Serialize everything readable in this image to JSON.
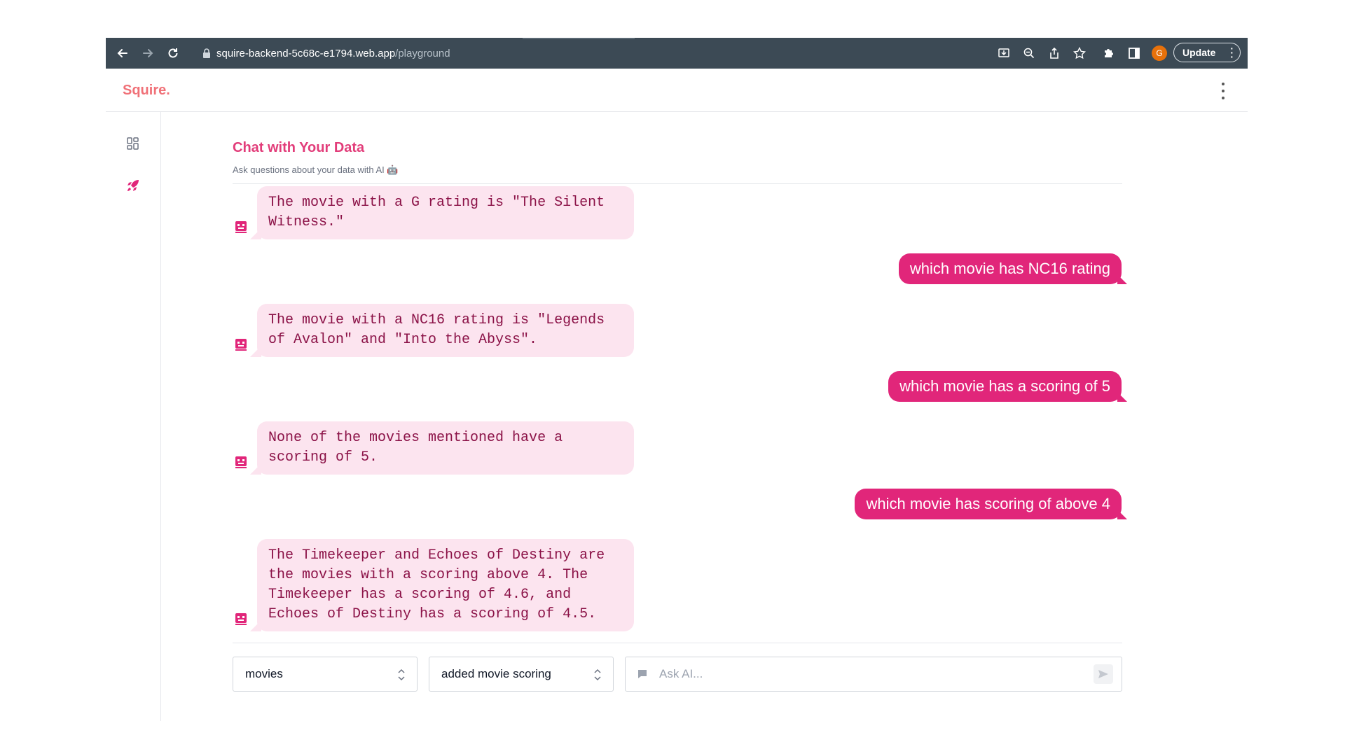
{
  "browser": {
    "url_host": "squire-backend-5c68c-e1794.web.app",
    "url_path": "/playground",
    "profile_initial": "G",
    "update_label": "Update"
  },
  "app": {
    "brand": "Squire."
  },
  "main": {
    "title": "Chat with Your Data",
    "subtitle": "Ask questions about your data with AI 🤖"
  },
  "messages": [
    {
      "role": "ai",
      "text": "The movie with a G rating is \"The Silent Witness.\""
    },
    {
      "role": "user",
      "text": "which movie has NC16 rating"
    },
    {
      "role": "ai",
      "text": "The movie with a NC16 rating is \"Legends of Avalon\" and \"Into the Abyss\"."
    },
    {
      "role": "user",
      "text": "which movie has a scoring of 5"
    },
    {
      "role": "ai",
      "text": "None of the movies mentioned have a scoring of 5."
    },
    {
      "role": "user",
      "text": "which movie has scoring of above 4"
    },
    {
      "role": "ai",
      "text": "The Timekeeper and Echoes of Destiny are the movies with a scoring above 4. The Timekeeper has a scoring of 4.6, and Echoes of Destiny has a scoring of 4.5."
    }
  ],
  "composer": {
    "dataset_select": "movies",
    "version_select": "added movie scoring",
    "ask_placeholder": "Ask AI..."
  },
  "colors": {
    "accent": "#e1267a",
    "ai_bubble_bg": "#fce4ef",
    "ai_text": "#8b1247",
    "brand": "#f07178",
    "browser_bar": "#3c4a55"
  }
}
